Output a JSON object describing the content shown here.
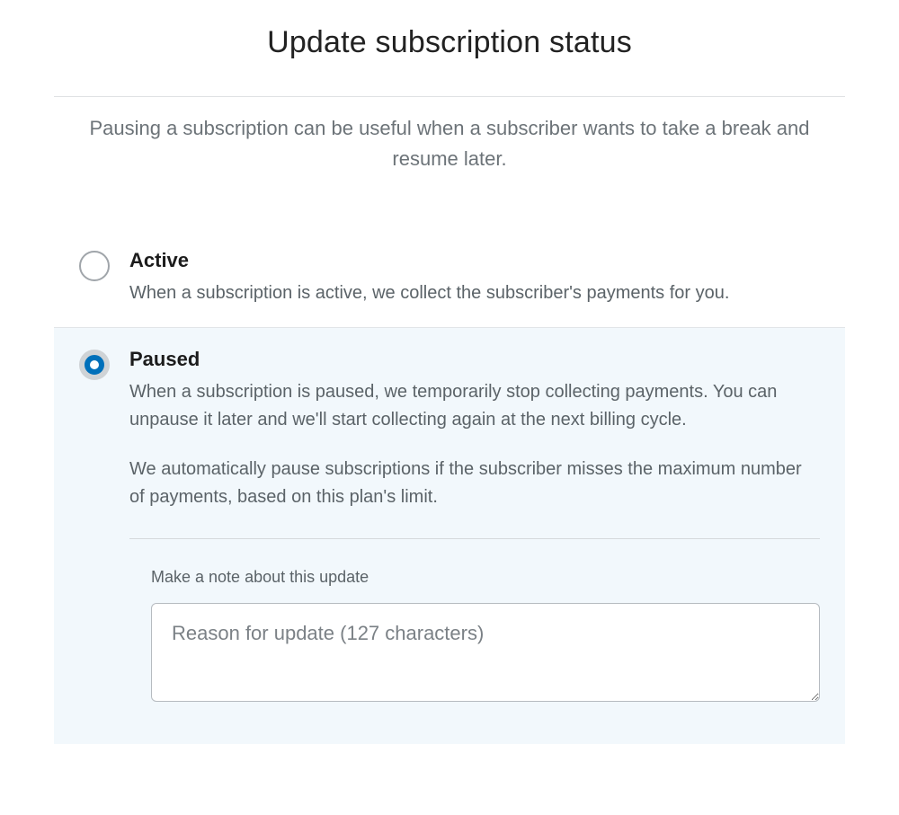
{
  "dialog": {
    "title": "Update subscription status",
    "intro": "Pausing a subscription can be useful when a subscriber wants to take a break and resume later."
  },
  "options": {
    "active": {
      "title": "Active",
      "description": "When a subscription is active, we collect the subscriber's payments for you.",
      "selected": false
    },
    "paused": {
      "title": "Paused",
      "description_p1": "When a subscription is paused, we temporarily stop collecting payments. You can unpause it later and we'll start collecting again at the next billing cycle.",
      "description_p2": "We automatically pause subscriptions if the subscriber misses the maximum number of payments, based on this plan's limit.",
      "selected": true
    }
  },
  "note": {
    "label": "Make a note about this update",
    "placeholder": "Reason for update (127 characters)",
    "value": ""
  }
}
